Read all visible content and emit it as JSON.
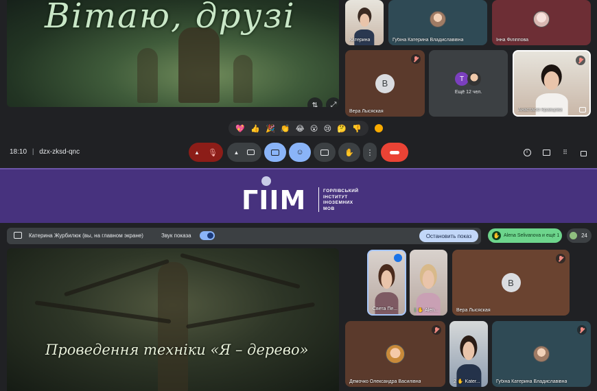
{
  "top": {
    "slide_title": "Вітаю, друзі",
    "participants": [
      {
        "name": "Катерина",
        "muted": false
      },
      {
        "name": "Губіна Катерина Владиславівна",
        "muted": false
      },
      {
        "name": "Інна Філіппова",
        "muted": false
      },
      {
        "name": "Вера Лысяская",
        "avatar_letter": "В",
        "muted": true
      },
      {
        "name": "Ещё 12 чел.",
        "avatar_letter": "T",
        "muted": false
      },
      {
        "name": "Анастасія Кравцова",
        "muted": true
      }
    ],
    "reactions": [
      "💖",
      "👍",
      "🎉",
      "👏",
      "😂",
      "😮",
      "😢",
      "🤔",
      "👎"
    ],
    "time": "18:10",
    "meeting_code": "dzx-zksd-qnc",
    "colors": {
      "end_call": "#ea4335",
      "active_blue": "#8ab4f8",
      "mic_off": "#8c1d18"
    }
  },
  "banner": {
    "logo_mark": "ГІІМ",
    "institute_lines": [
      "ГОРЛІВСЬКИЙ",
      "ІНСТИТУТ",
      "ІНОЗЕМНИХ",
      "МОВ"
    ],
    "background": "#47327e"
  },
  "share_bar": {
    "presenting_label": "Катерина Журбилюк (вы, на главном экране)",
    "sound_label": "Звук показа",
    "sound_on": true,
    "stop_button": "Остановить показ",
    "raised_hands": "Alena Selivanova и ещё 1",
    "participant_count": "24"
  },
  "bottom": {
    "slide_title": "Проведення техніки «Я – дерево»",
    "participants": [
      {
        "name": "Света Пе...",
        "muted": false
      },
      {
        "name": "Alen...",
        "hand_count": "1",
        "muted": false
      },
      {
        "name": "Вера Лысяская",
        "avatar_letter": "В",
        "muted": true
      },
      {
        "name": "Демочко Олександра Василівна",
        "muted": true
      },
      {
        "name": "Kater...",
        "hand_count": "2",
        "muted": false
      },
      {
        "name": "Губіна Катерина Владиславівна",
        "muted": true
      }
    ]
  }
}
